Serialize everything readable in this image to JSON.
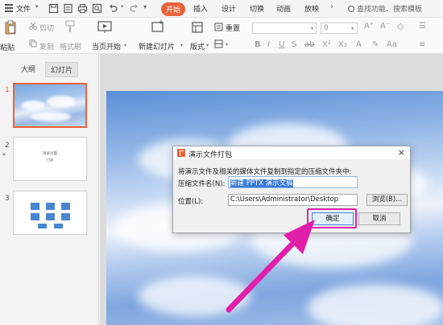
{
  "menubar": {
    "file": "文件",
    "tabs": [
      {
        "label": "开始",
        "active": true
      },
      {
        "label": "插入"
      },
      {
        "label": "设计"
      },
      {
        "label": "切换"
      },
      {
        "label": "动画"
      },
      {
        "label": "放映"
      }
    ],
    "more": "›",
    "search": "查找功能、搜索模板"
  },
  "ribbon": {
    "paste": "粘贴",
    "cut": "剪切",
    "copy": "复制",
    "format_painter": "格式刷",
    "from_current": "当页开始",
    "new_slide": "新建幻灯片",
    "layout": "版式",
    "reset": "重置",
    "font_size_value": "0"
  },
  "left_panel": {
    "tabs": [
      "大纲",
      "幻灯片"
    ],
    "slides": [
      {
        "num": "1"
      },
      {
        "num": "2",
        "title": "目录页面",
        "subtitle": "目录"
      },
      {
        "num": "3"
      }
    ],
    "mark": "*"
  },
  "dialog": {
    "title": "演示文件打包",
    "close": "×",
    "description": "将演示文件及相关的媒体文件复制到指定的压缩文件夹中:",
    "name_label": "压缩文件名(N):",
    "name_value": "新建 PPTX 演示文稿",
    "location_label": "位置(L):",
    "location_value": "C:\\Users\\Administrator\\Desktop",
    "browse": "浏览(B)...",
    "ok": "确定",
    "cancel": "取消"
  },
  "colors": {
    "accent": "#e9633a",
    "highlight": "#e21fa8",
    "selection": "#3a7bd5"
  }
}
